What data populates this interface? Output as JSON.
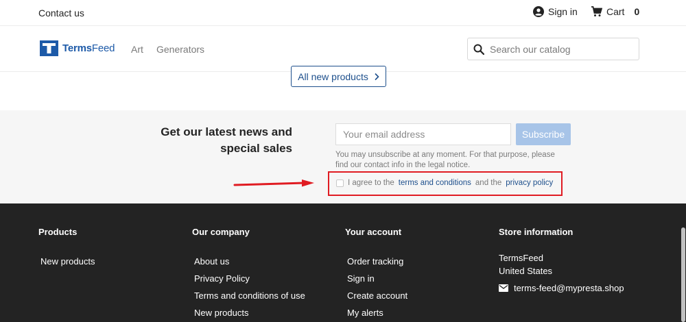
{
  "topbar": {
    "contact": "Contact us",
    "signin": "Sign in",
    "cart_label": "Cart",
    "cart_count": "0"
  },
  "header": {
    "logo_bold": "Terms",
    "logo_light": "Feed",
    "nav": [
      "Art",
      "Generators"
    ],
    "search_placeholder": "Search our catalog"
  },
  "products": {
    "all_new_label": "All new products"
  },
  "newsletter": {
    "title": "Get our latest news and special sales",
    "email_placeholder": "Your email address",
    "subscribe_label": "Subscribe",
    "note": "You may unsubscribe at any moment. For that purpose, please find our contact info in the legal notice.",
    "consent_prefix": "I agree to the",
    "terms_link": "terms and conditions",
    "consent_mid": "and the",
    "privacy_link": "privacy policy"
  },
  "footer": {
    "products": {
      "title": "Products",
      "items": [
        "New products"
      ]
    },
    "company": {
      "title": "Our company",
      "items": [
        "About us",
        "Privacy Policy",
        "Terms and conditions of use",
        "New products"
      ]
    },
    "account": {
      "title": "Your account",
      "items": [
        "Order tracking",
        "Sign in",
        "Create account",
        "My alerts"
      ]
    },
    "store": {
      "title": "Store information",
      "name": "TermsFeed",
      "country": "United States",
      "email": "terms-feed@mypresta.shop"
    }
  },
  "colors": {
    "brand": "#1d5aa8",
    "highlight": "#e01b22",
    "footer_bg": "#232323",
    "subscribe_bg": "#a7c4e8"
  }
}
